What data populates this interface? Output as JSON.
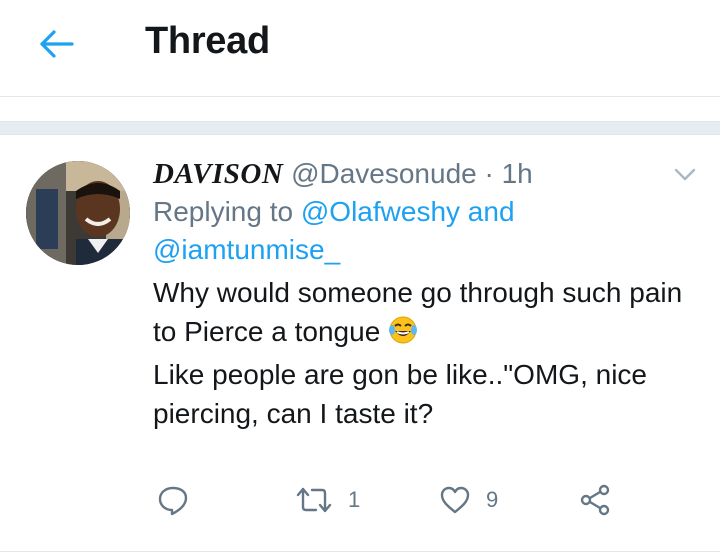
{
  "header": {
    "title": "Thread",
    "back_icon": "arrow-left-icon",
    "accent": "#1da1f2"
  },
  "tweet": {
    "display_name": "DAVISON",
    "handle": "@Davesonude",
    "separator": "·",
    "time": "1h",
    "replying_prefix": "Replying to",
    "replying_to_1": "@Olafweshy",
    "replying_join": "and",
    "replying_to_2": "@iamtunmise_",
    "text_line_1": "Why would someone go through such pain to Pierce a tongue",
    "text_emoji": "face-with-tears-of-joy",
    "text_line_2": "Like people are gon be like..\"OMG, nice piercing, can I taste it?",
    "actions": {
      "reply_icon": "reply-icon",
      "retweet_icon": "retweet-icon",
      "retweet_count": "1",
      "like_icon": "heart-icon",
      "like_count": "9",
      "share_icon": "share-icon"
    }
  }
}
